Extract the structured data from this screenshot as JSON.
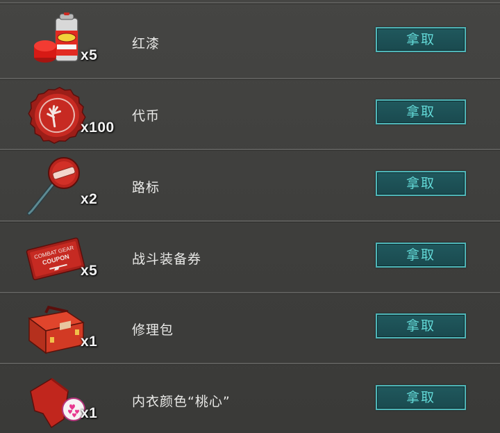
{
  "claim_label": "拿取",
  "items": [
    {
      "name": "红漆",
      "quantity": "x5",
      "icon": "red-paint-can-icon"
    },
    {
      "name": "代币",
      "quantity": "x100",
      "icon": "bottle-cap-token-icon"
    },
    {
      "name": "路标",
      "quantity": "x2",
      "icon": "road-sign-icon"
    },
    {
      "name": "战斗装备券",
      "quantity": "x5",
      "icon": "combat-gear-coupon-icon",
      "icon_text": [
        "COMBAT GEAR",
        "COUPON"
      ]
    },
    {
      "name": "修理包",
      "quantity": "x1",
      "icon": "repair-toolbox-icon"
    },
    {
      "name": "内衣颜色“桃心”",
      "quantity": "x1",
      "icon": "heart-underwear-icon"
    }
  ],
  "colors": {
    "background": "#3f3f3d",
    "button_fill": "#1d5257",
    "button_border": "#4fb6b8",
    "button_text": "#62d8d6",
    "item_text": "#e9e9e7",
    "divider": "#5c5c5a"
  }
}
